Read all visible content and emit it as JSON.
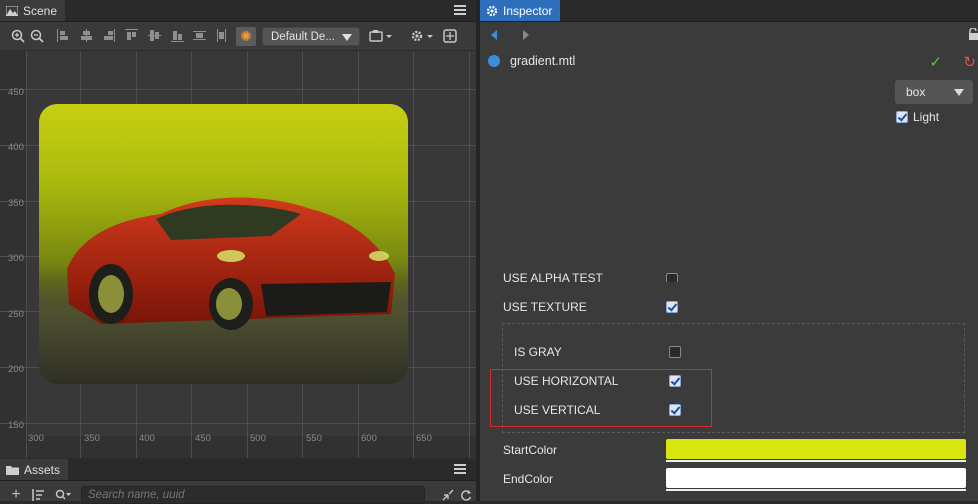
{
  "scene": {
    "tab_label": "Scene",
    "toolbar": {
      "layout_dropdown": "Default De..."
    },
    "y_ruler": [
      "450",
      "400",
      "350",
      "300",
      "250",
      "200",
      "150"
    ],
    "x_ruler": [
      "300",
      "350",
      "400",
      "450",
      "500",
      "550",
      "600",
      "650"
    ]
  },
  "assets": {
    "tab_label": "Assets",
    "search_placeholder": "Search name, uuid"
  },
  "inspector": {
    "tab_label": "Inspector",
    "asset_name": "gradient.mtl",
    "effect_dropdown": "box",
    "light_label": "Light",
    "light_checked": true,
    "props": {
      "use_alpha_test": {
        "label": "USE ALPHA TEST",
        "checked": false
      },
      "use_texture": {
        "label": "USE TEXTURE",
        "checked": true
      },
      "is_gray": {
        "label": "IS GRAY",
        "checked": false
      },
      "use_horizontal": {
        "label": "USE HORIZONTAL",
        "checked": true
      },
      "use_vertical": {
        "label": "USE VERTICAL",
        "checked": true
      }
    },
    "start_color_label": "StartColor",
    "start_color": "#d7e60c",
    "end_color_label": "EndColor",
    "end_color": "#ffffff"
  },
  "colors": {
    "accent_tab": "#2d6fbd",
    "highlight_box": "#d8282a"
  }
}
